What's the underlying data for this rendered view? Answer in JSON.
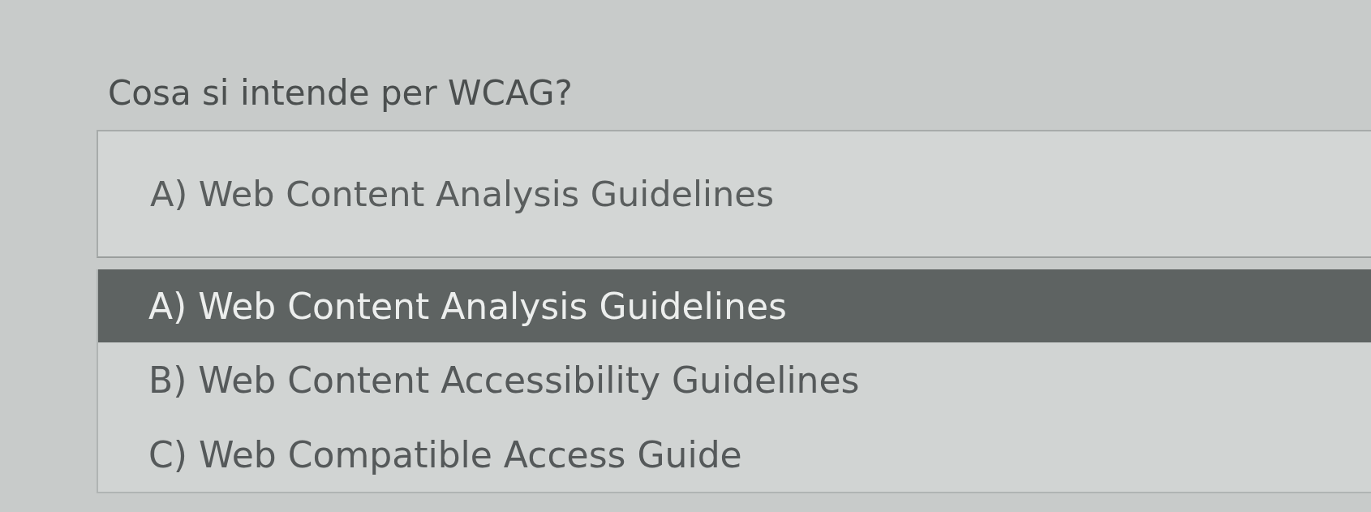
{
  "question": {
    "text": "Cosa si intende per WCAG?"
  },
  "select": {
    "value": "A) Web Content Analysis Guidelines",
    "expanded": true
  },
  "options": [
    {
      "label": "A) Web Content Analysis Guidelines",
      "selected": true
    },
    {
      "label": "B) Web Content Accessibility Guidelines",
      "selected": false
    },
    {
      "label": "C) Web Compatible Access Guide",
      "selected": false
    }
  ]
}
